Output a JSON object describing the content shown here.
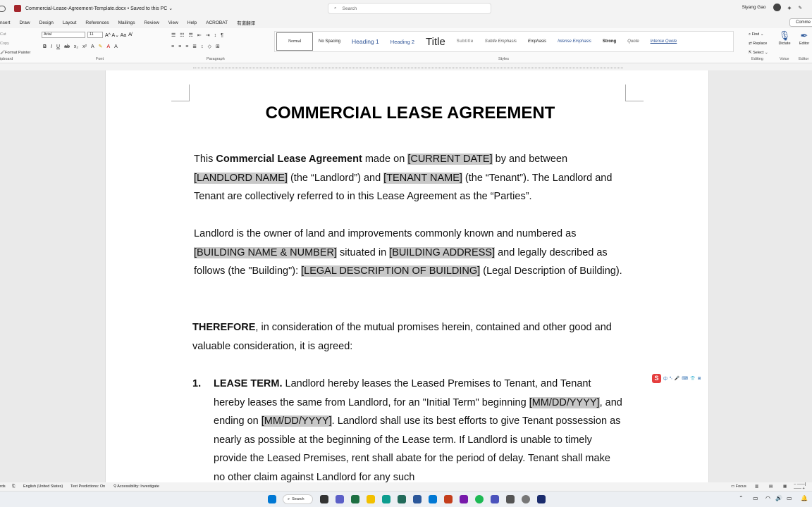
{
  "window": {
    "doc_name": "Commercial-Lease-Agreement-Template.docx",
    "save_status": "Saved to this PC",
    "search_placeholder": "Search",
    "user_name": "Siyang Gao"
  },
  "ribbon_tabs": [
    "nsert",
    "Draw",
    "Design",
    "Layout",
    "References",
    "Mailings",
    "Review",
    "View",
    "Help",
    "ACROBAT",
    "有道翻译"
  ],
  "comments_label": "Comme",
  "clipboard": {
    "cut": "Cut",
    "copy": "Copy",
    "format_painter": "Format Painter",
    "group": "ipboard"
  },
  "font": {
    "name": "Arial",
    "size": "11",
    "group": "Font"
  },
  "paragraph_group": "Paragraph",
  "styles": {
    "items": [
      "Normal",
      "No Spacing",
      "Heading 1",
      "Heading 2",
      "Title",
      "Subtitle",
      "Subtle Emphasis",
      "Emphasis",
      "Intense Emphasis",
      "Strong",
      "Quote",
      "Intense Quote"
    ],
    "group": "Styles"
  },
  "editing": {
    "find": "Find",
    "replace": "Replace",
    "select": "Select",
    "group": "Editing"
  },
  "voice": {
    "dictate": "Dictate",
    "group": "Voice"
  },
  "editor": {
    "label": "Editor",
    "group": "Editor"
  },
  "document": {
    "title": "COMMERCIAL LEASE AGREEMENT",
    "p1": {
      "t1": "This ",
      "b1": "Commercial Lease Agreement",
      "t2": " made on ",
      "f1": "[CURRENT DATE]",
      "t3": " by and between ",
      "f2": "[LANDLORD NAME]",
      "t4": " (the “Landlord”) and ",
      "f3": "[TENANT NAME]",
      "t5": " (the “Tenant”). The Landlord and Tenant are collectively referred to in this Lease Agreement as the “Parties”."
    },
    "p2": {
      "t1": "Landlord is the owner of land and improvements commonly known and numbered as ",
      "f1": "[BUILDING NAME & NUMBER]",
      "t2": " situated in ",
      "f2": "[BUILDING ADDRESS]",
      "t3": " and legally described as follows (the \"Building\"): ",
      "f3": "[LEGAL DESCRIPTION OF BUILDING]",
      "t4": " (Legal Description of Building)."
    },
    "p3": {
      "b1": "THEREFORE",
      "t1": ", in consideration of the mutual promises herein, contained and other good and valuable consideration, it is agreed:"
    },
    "item1": {
      "number": "1.",
      "heading": "LEASE TERM.",
      "t1": " Landlord hereby leases the Leased Premises to Tenant, and Tenant hereby leases the same from Landlord, for an \"Initial Term\" beginning ",
      "f1": "[MM/DD/YYYY]",
      "t2": ", and ending on ",
      "f2": "[MM/DD/YYYY]",
      "t3": ". Landlord shall use its best efforts to give Tenant possession as nearly as possible at the beginning of the Lease term. If Landlord is unable to timely provide the Leased Premises, rent shall abate for the period of delay. Tenant shall make no other claim against Landlord for any such"
    }
  },
  "ime_bar": {
    "logo": "S",
    "label": "中"
  },
  "statusbar": {
    "words": "rds",
    "language": "English (United States)",
    "predictions": "Text Predictions: On",
    "accessibility": "Accessibility: Investigate",
    "focus": "Focus"
  },
  "taskbar": {
    "search": "Search"
  },
  "colors": {
    "field_highlight": "#c8c8c8",
    "word_brand": "#a4262c",
    "accent": "#2b579a"
  }
}
